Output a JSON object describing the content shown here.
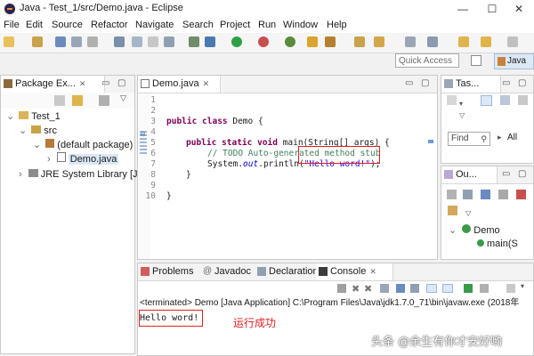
{
  "window": {
    "title": "Java - Test_1/src/Demo.java - Eclipse",
    "minimize": "—",
    "maximize": "☐",
    "close": "✕"
  },
  "menu": [
    "File",
    "Edit",
    "Source",
    "Refactor",
    "Navigate",
    "Search",
    "Project",
    "Run",
    "Window",
    "Help"
  ],
  "quick_access": {
    "placeholder": "Quick Access"
  },
  "perspective": {
    "label": "Java"
  },
  "package_explorer": {
    "tab": "Package Ex...",
    "tree": [
      {
        "label": "Test_1"
      },
      {
        "label": "src"
      },
      {
        "label": "(default package)"
      },
      {
        "label": "Demo.java"
      },
      {
        "label": "JRE System Library [J"
      }
    ]
  },
  "editor": {
    "tab": "Demo.java",
    "line_numbers": [
      "1",
      "2",
      "3",
      "4",
      "5",
      "6",
      "7",
      "8",
      "9",
      "10"
    ],
    "code": {
      "l3_kw": "public class",
      "l3_rest": " Demo {",
      "l5_kw": "public static void",
      "l5_rest": " main(String[] args) {",
      "l6_cm": "// TODO Auto-generated method stub",
      "l7_pre": "System.",
      "l7_out": "out",
      "l7_mid": ".println(",
      "l7_str": "\"Hello word!\"",
      "l7_end": ");",
      "l8": "}",
      "l10": "}"
    }
  },
  "task_view": {
    "tab": "Tas...",
    "find_placeholder": "Find",
    "all_label": "All"
  },
  "outline_view": {
    "tab": "Ou...",
    "class_label": "Demo",
    "method_label": "main(S"
  },
  "bottom_tabs": [
    "Problems",
    "Javadoc",
    "Declaration",
    "Console"
  ],
  "console": {
    "header": "<terminated> Demo [Java Application] C:\\Program Files\\Java\\jdk1.7.0_71\\bin\\javaw.exe (2018年",
    "output": "Hello word!",
    "annotation": "运行成功"
  },
  "watermark": "头条 @余生有你才安好哟",
  "colors": {
    "keyword": "#7f0055",
    "comment": "#3f7f5f",
    "string": "#2a00ff",
    "highlight_box": "#e02020",
    "annotation": "#e02020"
  }
}
